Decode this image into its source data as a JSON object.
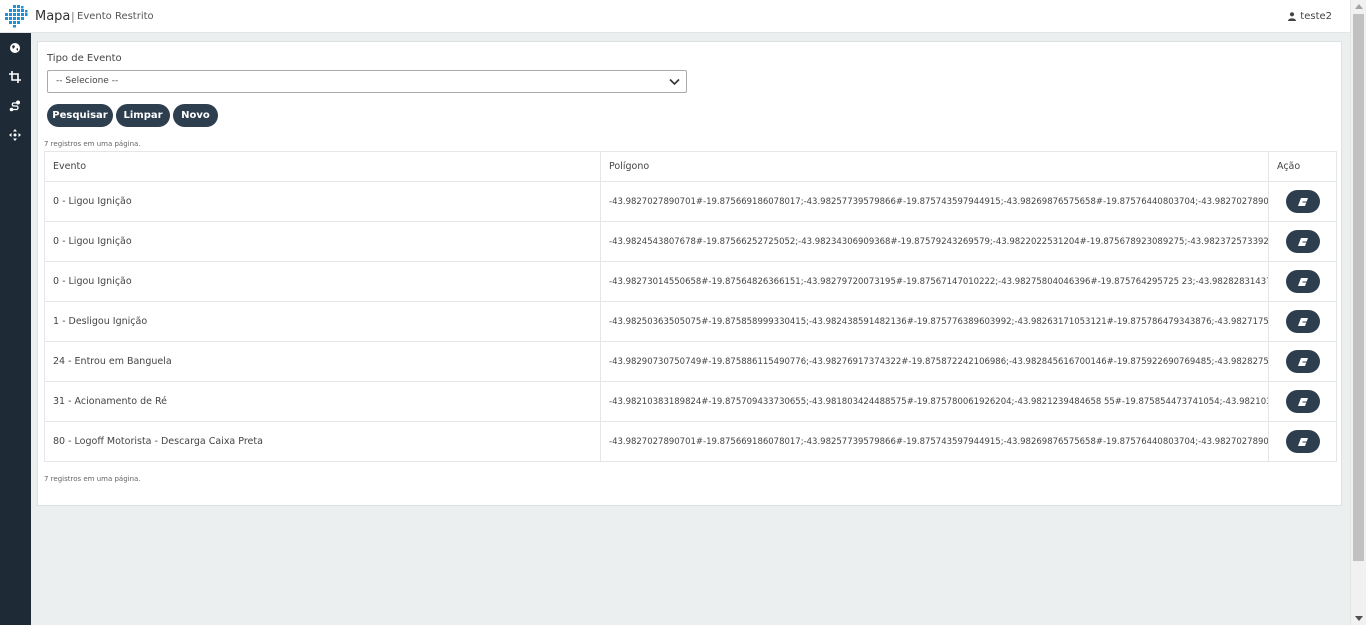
{
  "header": {
    "app_title": "Mapa",
    "separator": "|",
    "page_title": "Evento Restrito",
    "user_name": "teste2"
  },
  "sidebar": {
    "items": [
      {
        "icon": "globe-icon"
      },
      {
        "icon": "crop-icon"
      },
      {
        "icon": "route-icon"
      },
      {
        "icon": "move-icon"
      }
    ]
  },
  "filters": {
    "event_type_label": "Tipo de Evento",
    "event_type_selected": "-- Selecione --"
  },
  "buttons": {
    "search": "Pesquisar",
    "clear": "Limpar",
    "new": "Novo"
  },
  "records_info_top": "7 registros em uma página.",
  "records_info_bottom": "7 registros em uma página.",
  "table": {
    "columns": [
      "Evento",
      "Polígono",
      "Ação"
    ],
    "rows": [
      {
        "evento": "0 - Ligou Ignição",
        "poligono": "-43.9827027890701#-19.875669186078017;-43.98257739579866#-19.875743597944915;-43.98269876575658#-19.87576440803704;-43.98270278907"
      },
      {
        "evento": "0 - Ligou Ignição",
        "poligono": "-43.9824543807678#-19.87566252725052;-43.98234306909368#-19.87579243269579;-43.9822022531204#-19.875678923089275;-43.9823725733928"
      },
      {
        "evento": "0 - Ligou Ignição",
        "poligono": "-43.98273014550658#-19.87564826366151;-43.98279720073195#-19.87567147010222;-43.98275804046396#-19.875764295725 23;-43.982828314372"
      },
      {
        "evento": "1 - Desligou Ignição",
        "poligono": "-43.98250363505075#-19.875858999330415;-43.982438591482136#-19.875776389603992;-43.98263171053121#-19.875786479343876;-43.98271754"
      },
      {
        "evento": "24 - Entrou em Banguela",
        "poligono": "-43.98290730750749#-19.875886115490776;-43.98276917374322#-19.875872242106986;-43.982845616700146#-19.875922690769485;-43.98282751"
      },
      {
        "evento": "31 - Acionamento de Ré",
        "poligono": "-43.98210383189824#-19.875709433730655;-43.981803424488575#-19.875780061926204;-43.9821239484658 55#-19.875854473741054;-43.9821038"
      },
      {
        "evento": "80 - Logoff Motorista - Descarga Caixa Preta",
        "poligono": "-43.9827027890701#-19.875669186078017;-43.98257739579866#-19.875743597944915;-43.98269876575658#-19.87576440803704;-43.98270278907"
      }
    ]
  },
  "colors": {
    "sidebar_bg": "#1e2b36",
    "button_bg": "#2d3e4f",
    "page_bg": "#eceff0"
  }
}
